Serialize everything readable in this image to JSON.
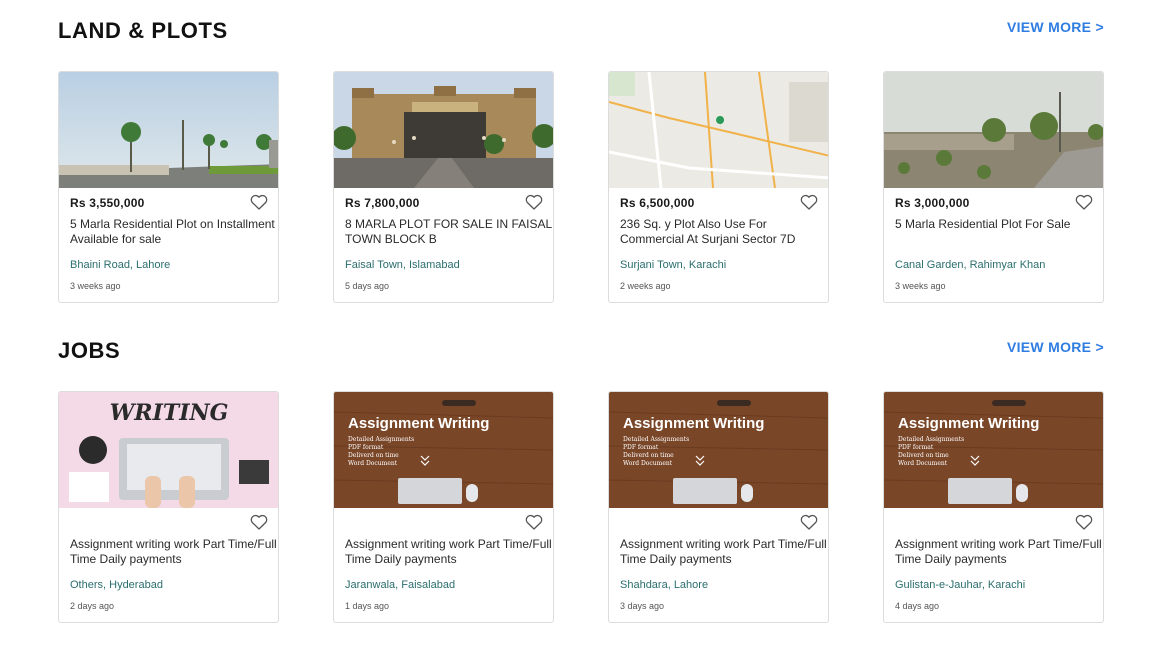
{
  "land": {
    "title": "LAND & PLOTS",
    "view_more": "VIEW MORE >",
    "listings": [
      {
        "price": "Rs 3,550,000",
        "title": "5 Marla Residential Plot on Installment Available for sale",
        "location": "Bhaini Road, Lahore",
        "time": "3 weeks ago"
      },
      {
        "price": "Rs 7,800,000",
        "title": "8 MARLA PLOT FOR SALE IN FAISAL TOWN BLOCK B",
        "location": "Faisal Town, Islamabad",
        "time": "5 days ago"
      },
      {
        "price": "Rs 6,500,000",
        "title": "236 Sq. y Plot Also Use For Commercial At Surjani Sector 7D",
        "location": "Surjani Town, Karachi",
        "time": "2 weeks ago"
      },
      {
        "price": "Rs 3,000,000",
        "title": "5 Marla Residential Plot For Sale",
        "location": "Canal Garden, Rahimyar Khan",
        "time": "3 weeks ago"
      }
    ]
  },
  "jobs": {
    "title": "JOBS",
    "view_more": "VIEW MORE >",
    "listings": [
      {
        "title": "Assignment writing work Part Time/Full Time Daily payments",
        "location": "Others, Hyderabad",
        "time": "2 days ago",
        "image_text": "WRITING"
      },
      {
        "title": "Assignment writing work Part Time/Full Time Daily payments",
        "location": "Jaranwala, Faisalabad",
        "time": "1 days ago",
        "image_text": "Assignment Writing"
      },
      {
        "title": "Assignment writing work Part Time/Full Time Daily payments",
        "location": "Shahdara, Lahore",
        "time": "3 days ago",
        "image_text": "Assignment Writing"
      },
      {
        "title": "Assignment writing work Part Time/Full Time Daily payments",
        "location": "Gulistan-e-Jauhar, Karachi",
        "time": "4 days ago",
        "image_text": "Assignment Writing"
      }
    ],
    "image_bullets": [
      "Detailed Assignments",
      "PDF format",
      "Deliverd on time",
      "Word Document"
    ]
  },
  "icons": {
    "favorite": "heart-outline-icon"
  },
  "colors": {
    "accent": "#2f7de1",
    "location": "#2b6e6e"
  }
}
